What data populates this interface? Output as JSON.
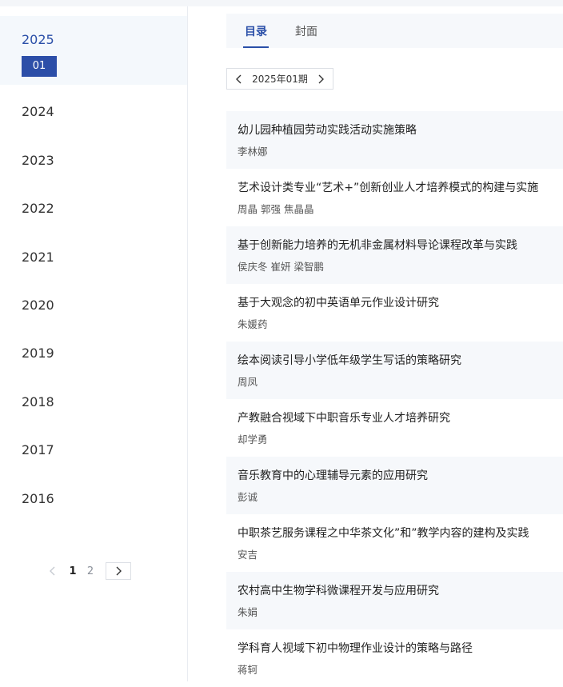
{
  "sidebar": {
    "active_year": "2025",
    "active_issue": "01",
    "years": [
      "2024",
      "2023",
      "2022",
      "2021",
      "2020",
      "2019",
      "2018",
      "2017",
      "2016"
    ],
    "pagination": {
      "pages": [
        "1",
        "2"
      ],
      "current": "1"
    }
  },
  "tabs": [
    {
      "label": "目录",
      "active": true
    },
    {
      "label": "封面",
      "active": false
    }
  ],
  "issue_selector": {
    "label": "2025年01期"
  },
  "articles": [
    {
      "title": "幼儿园种植园劳动实践活动实施策略",
      "authors": "李林娜"
    },
    {
      "title": "艺术设计类专业“艺术+”创新创业人才培养模式的构建与实施",
      "authors": "周晶  郭强  焦晶晶"
    },
    {
      "title": "基于创新能力培养的无机非金属材料导论课程改革与实践",
      "authors": "侯庆冬  崔妍  梁智鹏"
    },
    {
      "title": "基于大观念的初中英语单元作业设计研究",
      "authors": "朱媛药"
    },
    {
      "title": "绘本阅读引导小学低年级学生写话的策略研究",
      "authors": "周凤"
    },
    {
      "title": "产教融合视域下中职音乐专业人才培养研究",
      "authors": "却学勇"
    },
    {
      "title": "音乐教育中的心理辅导元素的应用研究",
      "authors": "彭诚"
    },
    {
      "title": "中职茶艺服务课程之中华茶文化”和”教学内容的建构及实践",
      "authors": "安吉"
    },
    {
      "title": "农村高中生物学科微课程开发与应用研究",
      "authors": "朱娟"
    },
    {
      "title": "学科育人视域下初中物理作业设计的策略与路径",
      "authors": "蒋轲"
    }
  ],
  "colors": {
    "accent": "#2c4ea8",
    "shade": "#f6f8fb"
  },
  "icons": {
    "prev": "chevron-left-icon",
    "next": "chevron-right-icon"
  }
}
